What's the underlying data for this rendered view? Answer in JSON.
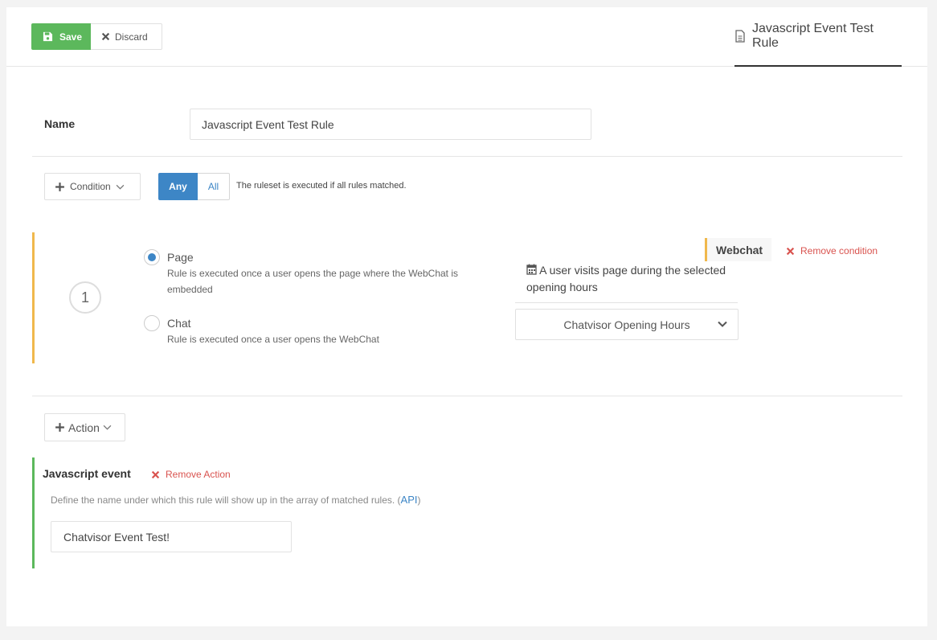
{
  "toolbar": {
    "save_label": "Save",
    "discard_label": "Discard"
  },
  "tab": {
    "title": "Javascript Event Test Rule"
  },
  "name_field": {
    "label": "Name",
    "value": "Javascript Event Test Rule"
  },
  "condition_bar": {
    "add_label": "Condition",
    "match_options": [
      {
        "label": "Any",
        "selected": true
      },
      {
        "label": "All",
        "selected": false
      }
    ],
    "note": "The ruleset is executed if all rules matched."
  },
  "condition": {
    "number": "1",
    "options": [
      {
        "title": "Page",
        "description": "Rule is executed once a user opens the page where the WebChat is embedded",
        "checked": true
      },
      {
        "title": "Chat",
        "description": "Rule is executed once a user opens the WebChat",
        "checked": false
      }
    ],
    "tag": "Webchat",
    "remove_label": "Remove condition",
    "visit_text": "A user visits page during the selected opening hours",
    "select_value": "Chatvisor Opening Hours"
  },
  "action_bar": {
    "add_label": "Action"
  },
  "action": {
    "title": "Javascript event",
    "remove_label": "Remove Action",
    "description": "Define the name under which this rule will show up in the array of matched rules. (",
    "api_link": "API",
    "description_end": ")",
    "event_value": "Chatvisor Event Test!"
  },
  "colors": {
    "save": "#5cb85c",
    "accent": "#3d86c6",
    "condition_bar": "#f0b84c",
    "remove": "#d9534f"
  }
}
